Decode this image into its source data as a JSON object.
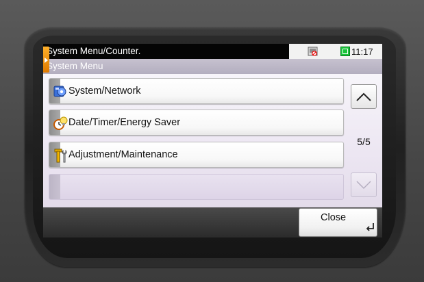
{
  "header": {
    "title": "System Menu/Counter.",
    "subtitle": "System Menu",
    "time": "11:17",
    "status_icons": [
      "network-status-icon",
      "memory-status-icon"
    ]
  },
  "menu": {
    "items": [
      {
        "label": "System/Network",
        "icon": "system-network-icon"
      },
      {
        "label": "Date/Timer/Energy Saver",
        "icon": "date-timer-icon"
      },
      {
        "label": "Adjustment/Maintenance",
        "icon": "adjustment-tools-icon"
      }
    ]
  },
  "pagination": {
    "page": "5/5"
  },
  "footer": {
    "close_label": "Close"
  },
  "colors": {
    "accent_tab": "#f08a00",
    "status_green": "#19c43a"
  }
}
